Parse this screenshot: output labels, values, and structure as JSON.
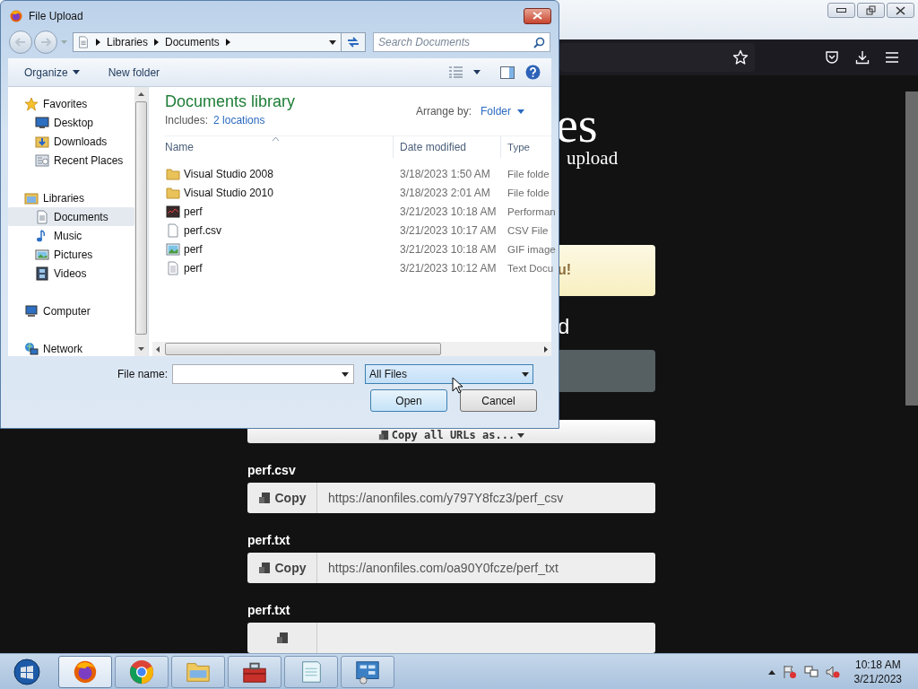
{
  "browser": {
    "page": {
      "heading_fragment": "es",
      "subtitle_fragment": "upload",
      "alert_fragment": "u!",
      "section_fragment": "d",
      "copy_all": "Copy all URLs as...",
      "files": [
        {
          "name": "perf.csv",
          "copy": "Copy",
          "url": "https://anonfiles.com/y797Y8fcz3/perf_csv"
        },
        {
          "name": "perf.txt",
          "copy": "Copy",
          "url": "https://anonfiles.com/oa90Y0fcze/perf_txt"
        },
        {
          "name": "perf.txt"
        }
      ]
    }
  },
  "dialog": {
    "title": "File Upload",
    "breadcrumbs": [
      "Libraries",
      "Documents"
    ],
    "search": {
      "placeholder": "Search Documents"
    },
    "toolbar": [
      "Organize",
      "New folder"
    ],
    "nav": [
      {
        "label": "Favorites",
        "kind": "star",
        "selected": false,
        "children": [
          {
            "label": "Desktop",
            "kind": "desktop",
            "selected": false
          },
          {
            "label": "Downloads",
            "kind": "downloads",
            "selected": false
          },
          {
            "label": "Recent Places",
            "kind": "recent",
            "selected": false
          }
        ]
      },
      {
        "label": "Libraries",
        "kind": "library",
        "selected": false,
        "children": [
          {
            "label": "Documents",
            "kind": "documents",
            "selected": true
          },
          {
            "label": "Music",
            "kind": "music",
            "selected": false
          },
          {
            "label": "Pictures",
            "kind": "pictures",
            "selected": false
          },
          {
            "label": "Videos",
            "kind": "videos",
            "selected": false
          }
        ]
      },
      {
        "label": "Computer",
        "kind": "computer",
        "selected": false
      },
      {
        "label": "Network",
        "kind": "network",
        "selected": false
      }
    ],
    "library": {
      "title": "Documents library",
      "includes_label": "Includes:",
      "includes_link": "2 locations",
      "arrange_label": "Arrange by:",
      "arrange_value": "Folder"
    },
    "columns": [
      "Name",
      "Date modified",
      "Type"
    ],
    "files": [
      {
        "name": "Visual Studio 2008",
        "date": "3/18/2023 1:50 AM",
        "type": "File folde",
        "kind": "folder"
      },
      {
        "name": "Visual Studio 2010",
        "date": "3/18/2023 2:01 AM",
        "type": "File folde",
        "kind": "folder"
      },
      {
        "name": "perf",
        "date": "3/21/2023 10:18 AM",
        "type": "Performan",
        "kind": "perf"
      },
      {
        "name": "perf.csv",
        "date": "3/21/2023 10:17 AM",
        "type": "CSV File",
        "kind": "csv"
      },
      {
        "name": "perf",
        "date": "3/21/2023 10:18 AM",
        "type": "GIF image",
        "kind": "gif"
      },
      {
        "name": "perf",
        "date": "3/21/2023 10:12 AM",
        "type": "Text Docu",
        "kind": "txt"
      }
    ],
    "file_name_label": "File name:",
    "filter": "All Files",
    "buttons": [
      "Open",
      "Cancel"
    ]
  },
  "taskbar": {
    "apps": [
      {
        "kind": "firefox",
        "selected": true
      },
      {
        "kind": "chrome",
        "selected": false
      },
      {
        "kind": "explorer",
        "selected": false
      },
      {
        "kind": "toolbox",
        "selected": false
      },
      {
        "kind": "notepad",
        "selected": false
      },
      {
        "kind": "control",
        "selected": false
      }
    ],
    "time": "10:18 AM",
    "date": "3/21/2023"
  }
}
